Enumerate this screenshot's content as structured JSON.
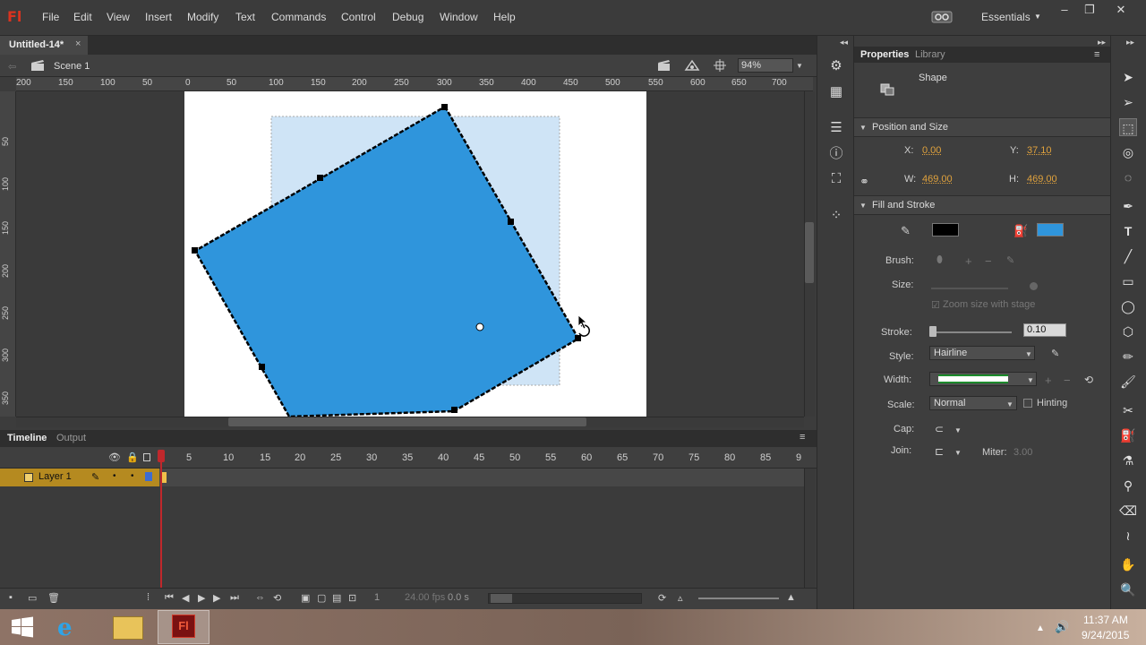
{
  "app": {
    "logo": "Fl"
  },
  "menu": [
    "File",
    "Edit",
    "View",
    "Insert",
    "Modify",
    "Text",
    "Commands",
    "Control",
    "Debug",
    "Window",
    "Help"
  ],
  "workspace": {
    "label": "Essentials"
  },
  "window_controls": {
    "minimize": "–",
    "restore": "❐",
    "close": "✕"
  },
  "document": {
    "tab_title": "Untitled-14*",
    "close": "×"
  },
  "editbar": {
    "scene": "Scene 1",
    "zoom": "94%"
  },
  "ruler": {
    "h_labels": [
      "200",
      "150",
      "100",
      "50",
      "0",
      "50",
      "100",
      "150",
      "200",
      "250",
      "300",
      "350",
      "400",
      "450",
      "500",
      "550",
      "600",
      "650",
      "700"
    ],
    "v_labels": [
      "50",
      "100",
      "150",
      "200",
      "250",
      "300",
      "350"
    ]
  },
  "colors": {
    "fill": "#2f95dc",
    "stroke": "#000000",
    "stage": "#ffffff",
    "layer_selected": "#b58a20",
    "playhead": "#c0282c"
  },
  "timeline": {
    "tabs": [
      "Timeline",
      "Output"
    ],
    "frame_numbers": [
      "1",
      "5",
      "10",
      "15",
      "20",
      "25",
      "30",
      "35",
      "40",
      "45",
      "50",
      "55",
      "60",
      "65",
      "70",
      "75",
      "80",
      "85",
      "9"
    ],
    "layer_name": "Layer 1",
    "current_frame": "1",
    "fps": "24.00 fps",
    "time": "0.0 s"
  },
  "properties": {
    "tabs": [
      "Properties",
      "Library"
    ],
    "type": "Shape",
    "position_size": {
      "title": "Position and Size",
      "x_label": "X:",
      "x": "0.00",
      "y_label": "Y:",
      "y": "37.10",
      "w_label": "W:",
      "w": "469.00",
      "h_label": "H:",
      "h": "469.00"
    },
    "fill_stroke": {
      "title": "Fill and Stroke",
      "stroke_color": "#000000",
      "fill_color": "#2f95dc",
      "brush_label": "Brush:",
      "size_label": "Size:",
      "zoom_with_stage": "Zoom size with stage",
      "stroke_label": "Stroke:",
      "stroke_value": "0.10",
      "style_label": "Style:",
      "style_value": "Hairline",
      "width_label": "Width:",
      "scale_label": "Scale:",
      "scale_value": "Normal",
      "hinting": "Hinting",
      "cap_label": "Cap:",
      "join_label": "Join:",
      "miter_label": "Miter:",
      "miter_value": "3.00"
    }
  },
  "clock": {
    "time": "11:37 AM",
    "date": "9/24/2015"
  }
}
